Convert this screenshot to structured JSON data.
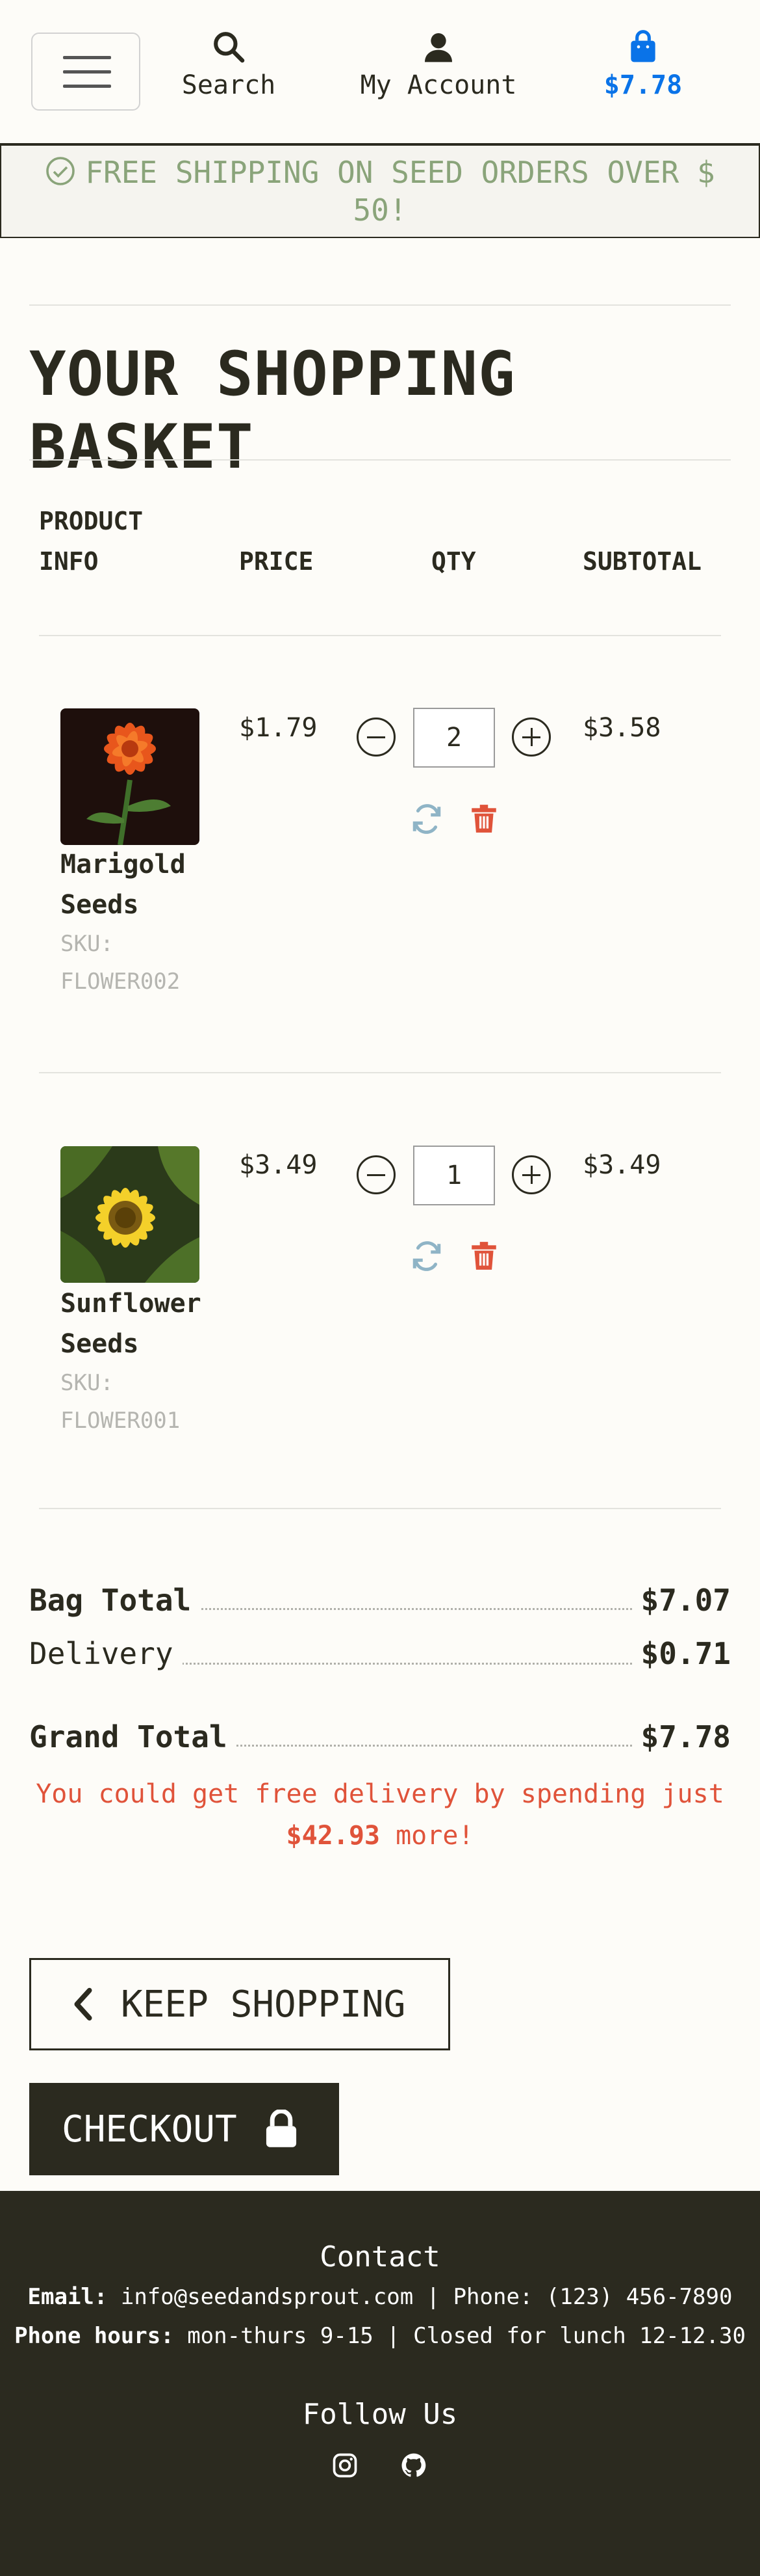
{
  "header": {
    "search_label": "Search",
    "account_label": "My Account",
    "cart_total": "$7.78",
    "accent_color": "#0a73e8"
  },
  "banner": {
    "text": "FREE SHIPPING ON SEED ORDERS OVER $ 50!",
    "icon": "check-circle-icon"
  },
  "page_title": "YOUR SHOPPING BASKET",
  "table": {
    "headers": {
      "product_line1": "PRODUCT",
      "product_line2": "INFO",
      "price": "PRICE",
      "qty": "QTY",
      "subtotal": "SUBTOTAL"
    },
    "items": [
      {
        "name_line1": "Marigold",
        "name_line2": "Seeds",
        "sku_label": "SKU:",
        "sku": "FLOWER002",
        "price": "$1.79",
        "qty": "2",
        "subtotal": "$3.58",
        "image": "marigold-flower"
      },
      {
        "name_line1": "Sunflower",
        "name_line2": "Seeds",
        "sku_label": "SKU:",
        "sku": "FLOWER001",
        "price": "$3.49",
        "qty": "1",
        "subtotal": "$3.49",
        "image": "sunflower"
      }
    ]
  },
  "totals": {
    "bag_label": "Bag Total",
    "bag_value": "$7.07",
    "delivery_label": "Delivery",
    "delivery_value": "$0.71",
    "grand_label": "Grand Total",
    "grand_value": "$7.78",
    "free_msg_prefix": "You could get free delivery by spending just",
    "free_msg_amount": "$42.93",
    "free_msg_suffix": "more!",
    "alert_color": "#e0533a"
  },
  "actions": {
    "keep_shopping": "KEEP SHOPPING",
    "checkout": "CHECKOUT"
  },
  "footer": {
    "contact_title": "Contact",
    "email_label": "Email:",
    "email_value": "info@seedandsprout.com | Phone: (123) 456-7890",
    "hours_label": "Phone hours:",
    "hours_value": "mon-thurs 9-15 | Closed for lunch 12-12.30",
    "follow_title": "Follow Us",
    "social": [
      "instagram-icon",
      "github-icon"
    ]
  }
}
